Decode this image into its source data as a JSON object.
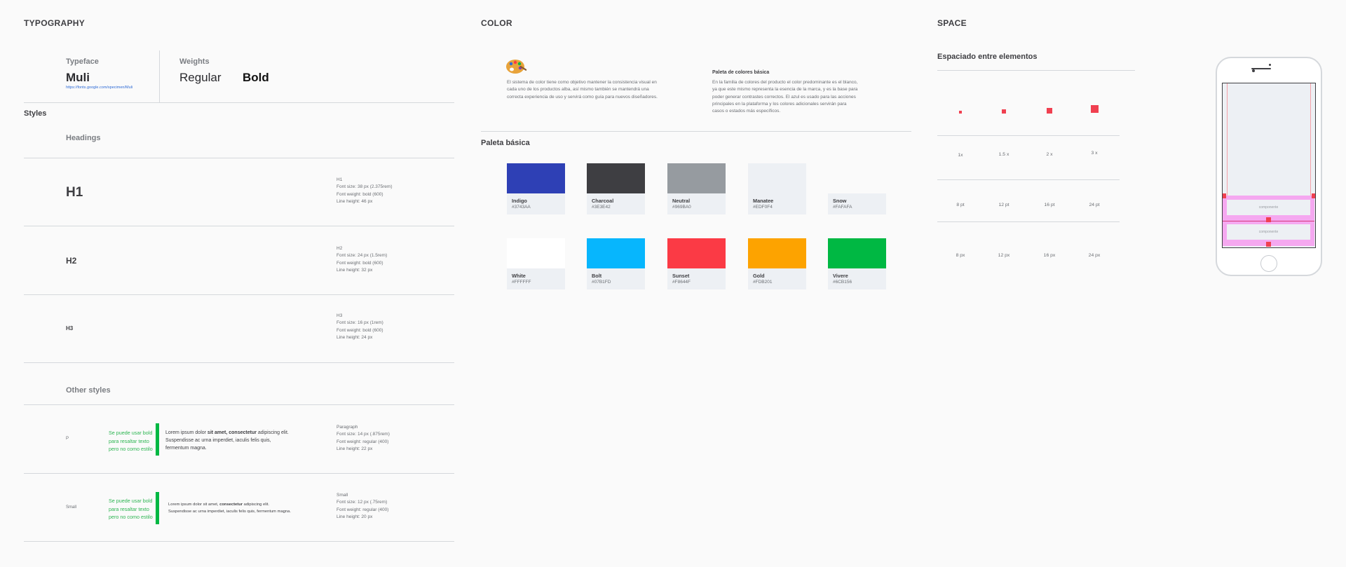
{
  "typography": {
    "title": "TYPOGRAPHY",
    "typeface_label": "Typeface",
    "typeface_name": "Muli",
    "typeface_link": "https://fonts.google.com/specimen/Muli",
    "weights_label": "Weights",
    "weight_regular": "Regular",
    "weight_bold": "Bold",
    "styles_label": "Styles",
    "headings_label": "Headings",
    "headings": [
      {
        "sample": "H1",
        "name": "H1",
        "size": "Font size: 38 px (2.375rem)",
        "weight": "Font weight: bold (600)",
        "line": "Line height: 46 px"
      },
      {
        "sample": "H2",
        "name": "H2",
        "size": "Font size: 24 px (1.5rem)",
        "weight": "Font weight: bold (600)",
        "line": "Line height: 32 px"
      },
      {
        "sample": "H3",
        "name": "H3",
        "size": "Font size: 16 px (1rem)",
        "weight": "Font weight: bold (600)",
        "line": "Line height: 24 px"
      }
    ],
    "other_label": "Other styles",
    "other": [
      {
        "tag": "P",
        "note": [
          "Se puede usar bold",
          "para resaltar texto",
          "pero no como estilo"
        ],
        "lorem_a": "Lorem ipsum dolor ",
        "lorem_b": "sit amet, consectetur",
        "lorem_c": " adipiscing elit.",
        "lorem_d": "Suspendisse ac urna imperdiet, iaculis felis quis,",
        "lorem_e": "fermentum magna.",
        "name": "Paragraph",
        "size": "Font size: 14 px (.875rem)",
        "weight": "Font weight: regular (400)",
        "line": "Line height: 22 px"
      },
      {
        "tag": "Small",
        "note": [
          "Se puede usar bold",
          "para resaltar texto",
          "pero no como estilo"
        ],
        "lorem_a": "Lorem ipsum dolor sit amet, ",
        "lorem_b": "consectetur",
        "lorem_c": " adipiscing elit.",
        "lorem_d": "Suspendisse ac urna imperdiet, iaculis felis quis, fermentum magna.",
        "name": "Small",
        "size": "Font size: 12 px (.75rem)",
        "weight": "Font weight: regular (400)",
        "line": "Line height: 20 px"
      }
    ]
  },
  "color": {
    "title": "COLOR",
    "intro": "El sistema de color tiene como objetivo mantener la consistencia visual en cada uno de los productos alba, así mismo también se mantendrá una correcta experiencia de uso y servirá como guía para nuevos diseñadores.",
    "basic_title": "Paleta de colores básica",
    "basic_text": "En la familia de colores del producto el color predominante es el blanco, ya que este mismo representa la esencia de la marca, y es la base para poder generar contrastes correctos. El azul es usado para las acciones principales en la plataforma y los colores adicionales servirán para casos o estados más específicos.",
    "palette_label": "Paleta básica",
    "swatches": [
      {
        "name": "Indigo",
        "hex": "#3743AA",
        "color": "#2E40B5"
      },
      {
        "name": "Charcoal",
        "hex": "#3E3E42",
        "color": "#3E3E42"
      },
      {
        "name": "Neutral",
        "hex": "#969BA0",
        "color": "#969BA0"
      },
      {
        "name": "Manatee",
        "hex": "#EDF0F4",
        "color": "#EDF0F4"
      },
      {
        "name": "Snow",
        "hex": "#FAFAFA",
        "color": "#FAFAFA"
      },
      {
        "name": "White",
        "hex": "#FFFFFF",
        "color": "#FFFFFF"
      },
      {
        "name": "Bolt",
        "hex": "#07B1FD",
        "color": "#07B6FD"
      },
      {
        "name": "Sunset",
        "hex": "#F8644F",
        "color": "#FB3A45"
      },
      {
        "name": "Gold",
        "hex": "#FDB201",
        "color": "#FDA300"
      },
      {
        "name": "Vivere",
        "hex": "#6CB156",
        "color": "#00B843"
      }
    ]
  },
  "space": {
    "title": "SPACE",
    "subtitle": "Espaciado entre elementos",
    "multipliers": [
      "1x",
      "1.5 x",
      "2 x",
      "3 x"
    ],
    "points": [
      "8 pt",
      "12 pt",
      "16 pt",
      "24 pt"
    ],
    "pixels": [
      "8 px",
      "12 px",
      "16 px",
      "24 px"
    ],
    "component_label": "componente"
  }
}
